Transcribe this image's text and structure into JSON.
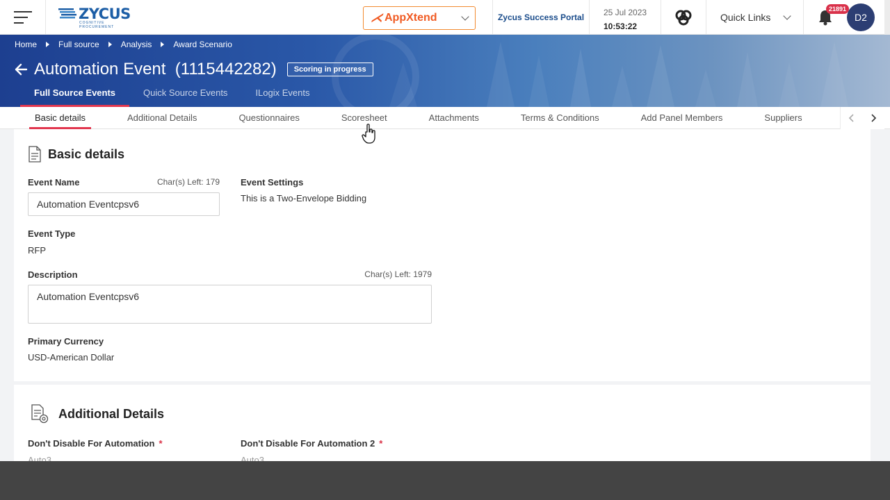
{
  "header": {
    "logo_text": "ZYCUS",
    "logo_tagline": "COGNITIVE PROCUREMENT",
    "appxtend_label": "AppXtend",
    "success_portal": "Zycus Success Portal",
    "date": "25 Jul 2023",
    "time": "10:53:22",
    "quick_links": "Quick Links",
    "notification_count": "21891",
    "user_initials": "D2"
  },
  "breadcrumb": [
    "Home",
    "Full source",
    "Analysis",
    "Award Scenario"
  ],
  "event": {
    "title": "Automation Event",
    "id": "(1115442282)",
    "status": "Scoring in progress"
  },
  "sub_nav": [
    {
      "label": "Full Source Events",
      "active": true
    },
    {
      "label": "Quick Source Events",
      "active": false
    },
    {
      "label": "ILogix Events",
      "active": false
    }
  ],
  "tabs": [
    {
      "label": "Basic details",
      "active": true
    },
    {
      "label": "Additional Details",
      "active": false
    },
    {
      "label": "Questionnaires",
      "active": false
    },
    {
      "label": "Scoresheet",
      "active": false
    },
    {
      "label": "Attachments",
      "active": false
    },
    {
      "label": "Terms & Conditions",
      "active": false
    },
    {
      "label": "Add Panel Members",
      "active": false
    },
    {
      "label": "Suppliers",
      "active": false
    }
  ],
  "basic_details": {
    "section_title": "Basic details",
    "event_name_label": "Event Name",
    "event_name_chars_left": "Char(s) Left: 179",
    "event_name_value": "Automation Eventcpsv6",
    "event_settings_label": "Event Settings",
    "event_settings_value": "This is a Two-Envelope Bidding",
    "event_type_label": "Event Type",
    "event_type_value": "RFP",
    "description_label": "Description",
    "description_chars_left": "Char(s) Left: 1979",
    "description_value": "Automation Eventcpsv6",
    "currency_label": "Primary Currency",
    "currency_value": "USD-American Dollar"
  },
  "additional_details": {
    "section_title": "Additional Details",
    "field1_label": "Don't Disable For Automation",
    "field1_value": "Auto3",
    "field2_label": "Don't Disable For Automation 2",
    "field2_value": "Auto3",
    "required_mark": "*"
  },
  "colors": {
    "accent": "#e2374f",
    "brand_blue": "#1c5ea6",
    "appxtend_orange": "#f05a22",
    "avatar": "#2c3e73"
  }
}
